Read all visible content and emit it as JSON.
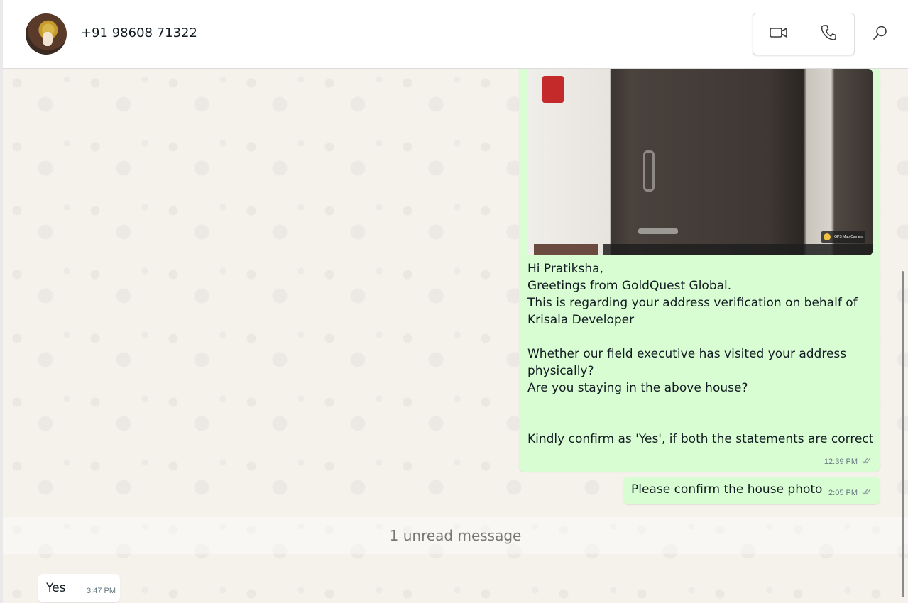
{
  "header": {
    "contact_name": "+91 98608 71322",
    "avatar_icon": "contact-avatar",
    "video_call_icon": "video-camera-icon",
    "voice_call_icon": "phone-icon",
    "search_icon": "search-icon"
  },
  "messages": [
    {
      "direction": "outgoing",
      "has_photo": true,
      "photo_watermark": "GPS Map Camera",
      "text": "Hi Pratiksha,\nGreetings from GoldQuest Global.\nThis is regarding your address verification on behalf of\nKrisala Developer\n\nWhether our field executive has visited your address\nphysically?\nAre you staying in the above house?\n\n\nKindly confirm as 'Yes', if both the statements are correct",
      "time": "12:39 PM",
      "status_icon": "double-check-icon"
    },
    {
      "direction": "outgoing",
      "text": "Please confirm the house photo",
      "time": "2:05 PM",
      "status_icon": "double-check-icon"
    },
    {
      "direction": "incoming",
      "text": "Yes",
      "time": "3:47 PM"
    }
  ],
  "unread_divider": "1 unread message",
  "colors": {
    "outgoing_bubble": "#d9fdd3",
    "incoming_bubble": "#ffffff",
    "chat_background": "#f5f1eb"
  }
}
